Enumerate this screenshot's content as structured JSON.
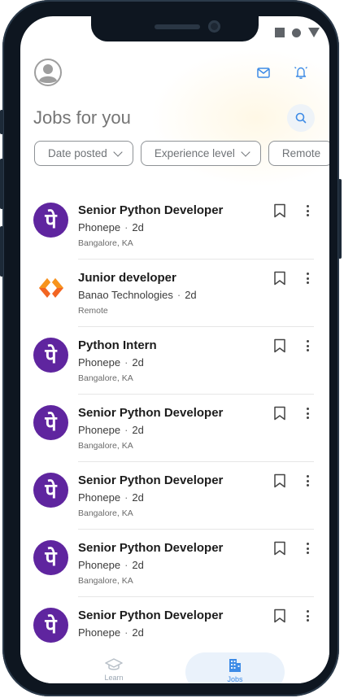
{
  "header": {
    "title": "Jobs for you",
    "icons": {
      "avatar": "avatar-icon",
      "mail": "mail-icon",
      "notifications": "bell-icon",
      "search": "search-icon"
    }
  },
  "filters": [
    {
      "label": "Date posted"
    },
    {
      "label": "Experience level"
    },
    {
      "label": "Remote"
    }
  ],
  "jobs": [
    {
      "title": "Senior Python Developer",
      "company": "Phonepe",
      "age": "2d",
      "location": "Bangalore, KA",
      "logo": "phonepe"
    },
    {
      "title": "Junior developer",
      "company": "Banao Technologies",
      "age": "2d",
      "location": "Remote",
      "logo": "banao"
    },
    {
      "title": "Python Intern",
      "company": "Phonepe",
      "age": "2d",
      "location": "Bangalore, KA",
      "logo": "phonepe"
    },
    {
      "title": "Senior Python Developer",
      "company": "Phonepe",
      "age": "2d",
      "location": "Bangalore, KA",
      "logo": "phonepe"
    },
    {
      "title": "Senior Python Developer",
      "company": "Phonepe",
      "age": "2d",
      "location": "Bangalore, KA",
      "logo": "phonepe"
    },
    {
      "title": "Senior Python Developer",
      "company": "Phonepe",
      "age": "2d",
      "location": "Bangalore, KA",
      "logo": "phonepe"
    },
    {
      "title": "Senior Python Developer",
      "company": "Phonepe",
      "age": "2d",
      "location": "",
      "logo": "phonepe"
    }
  ],
  "separator": "·",
  "phonepe_glyph": "पे",
  "nav": {
    "learn_label": "Learn",
    "jobs_label": "Jobs",
    "active": "jobs"
  },
  "colors": {
    "phonepe_purple": "#5f259f",
    "banao_orange": "#f26522",
    "accent_blue": "#3d8be6",
    "jobs_tab_bg": "#eaf2fb"
  }
}
